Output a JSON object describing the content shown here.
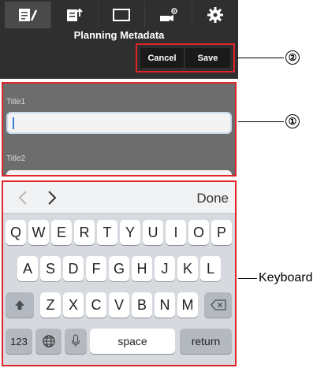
{
  "header": {
    "title": "Planning Metadata",
    "tabs": [
      {
        "icon": "edit-doc-icon",
        "active": true
      },
      {
        "icon": "export-doc-icon",
        "active": false
      },
      {
        "icon": "monitor-icon",
        "active": false
      },
      {
        "icon": "camera-settings-icon",
        "active": false
      },
      {
        "icon": "gear-icon",
        "active": false
      }
    ],
    "cancel_label": "Cancel",
    "save_label": "Save"
  },
  "form": {
    "field1_label": "Title1",
    "field1_value": "",
    "field2_label": "Title2",
    "field2_value": ""
  },
  "keyboard": {
    "done_label": "Done",
    "row1": [
      "Q",
      "W",
      "E",
      "R",
      "T",
      "Y",
      "U",
      "I",
      "O",
      "P"
    ],
    "row2": [
      "A",
      "S",
      "D",
      "F",
      "G",
      "H",
      "J",
      "K",
      "L"
    ],
    "row3": [
      "Z",
      "X",
      "C",
      "V",
      "B",
      "N",
      "M"
    ],
    "numbers_label": "123",
    "space_label": "space",
    "return_label": "return"
  },
  "callouts": {
    "save_cancel": "②",
    "input_field": "①",
    "keyboard": "Keyboard"
  },
  "colors": {
    "header_bg": "#2f2f2f",
    "highlight_red": "#e0242a",
    "form_bg": "#6d6d6d",
    "keyboard_bg": "#d6d9de"
  }
}
